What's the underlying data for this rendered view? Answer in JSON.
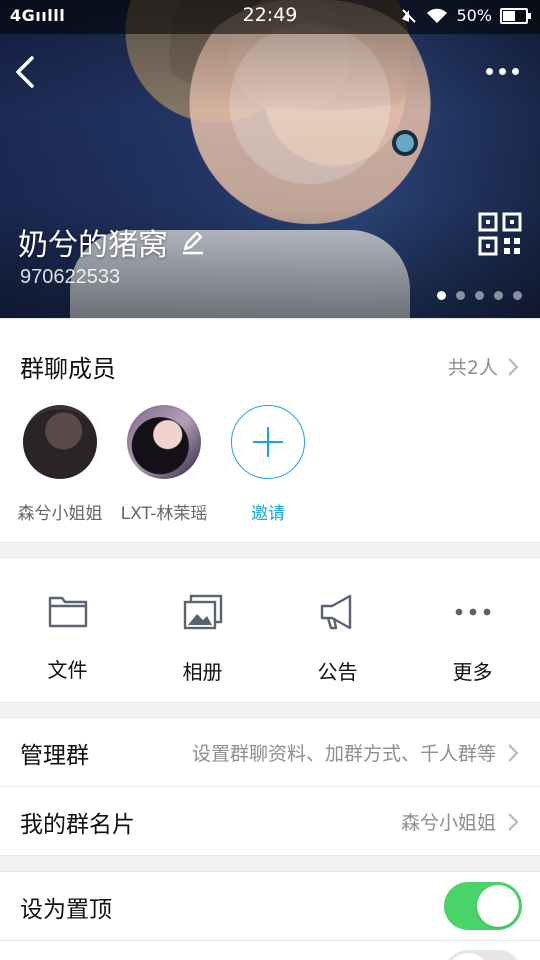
{
  "status_bar": {
    "network": "4G",
    "signal": "ıılll",
    "time": "22:49",
    "battery": "50%"
  },
  "header": {
    "group_name": "奶兮的猪窝",
    "group_id": "970622533",
    "page_count": 5,
    "active_page": 1
  },
  "members": {
    "title": "群聊成员",
    "count_text": "共2人",
    "list": [
      {
        "name": "森兮小姐姐"
      },
      {
        "name": "LXT-林茉瑶"
      }
    ],
    "invite_label": "邀请"
  },
  "features": [
    {
      "label": "文件",
      "icon": "folder-icon"
    },
    {
      "label": "相册",
      "icon": "album-icon"
    },
    {
      "label": "公告",
      "icon": "megaphone-icon"
    },
    {
      "label": "更多",
      "icon": "more-dots-icon"
    }
  ],
  "settings": {
    "manage": {
      "label": "管理群",
      "value": "设置群聊资料、加群方式、千人群等"
    },
    "card": {
      "label": "我的群名片",
      "value": "森兮小姐姐"
    },
    "pin": {
      "label": "设为置顶",
      "enabled": true
    }
  },
  "colors": {
    "accent": "#18a4e0",
    "toggle_on": "#48d468"
  }
}
